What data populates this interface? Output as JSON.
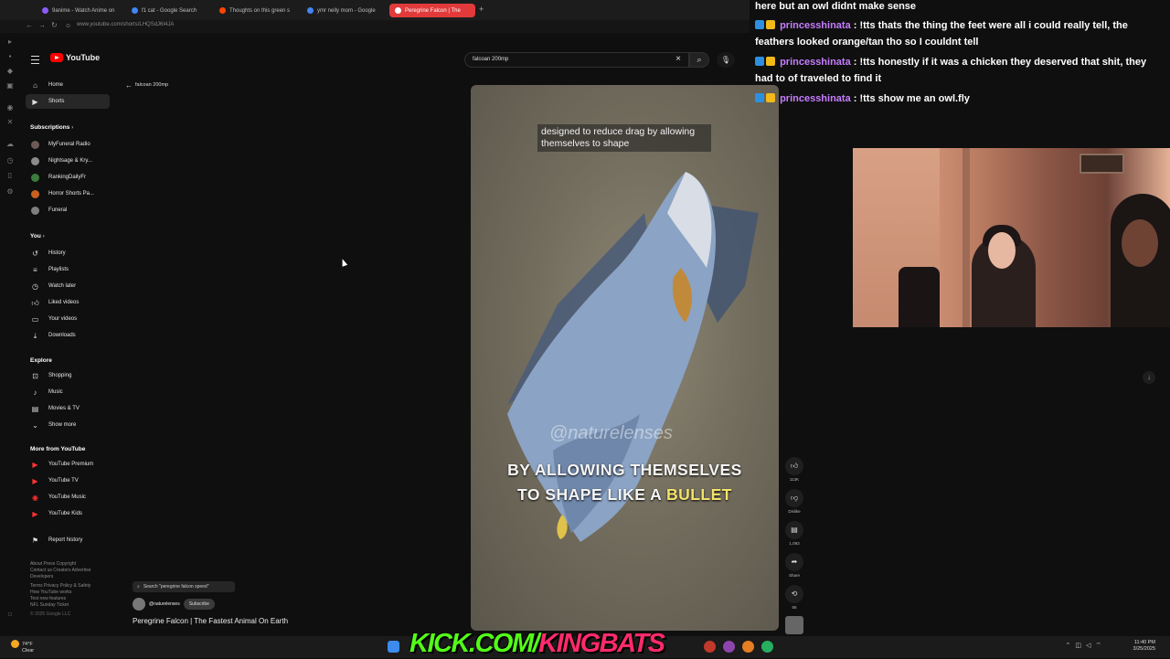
{
  "browser": {
    "tabs": [
      {
        "label": "9anime - Watch Anime on",
        "color": "#8a5cf6"
      },
      {
        "label": "f1 cat - Google Search",
        "color": "#4285f4"
      },
      {
        "label": "Thoughts on this green s",
        "color": "#ff4500"
      },
      {
        "label": "ymr nelly mom - Google",
        "color": "#4285f4"
      },
      {
        "label": "Peregrine Falcon | The",
        "color": "#ff0000"
      }
    ],
    "url": "www.youtube.com/shorts/LHQSdJ6I4JA"
  },
  "youtube": {
    "brand": "YouTube",
    "search": {
      "query": "falcoan 200mp"
    },
    "back_label": "falcoan 200mp",
    "nav": [
      {
        "label": "Home",
        "icon": "home-icon"
      },
      {
        "label": "Shorts",
        "icon": "shorts-icon"
      }
    ],
    "subscriptions_title": "Subscriptions",
    "subscriptions": [
      {
        "label": "MyFuneral Radio"
      },
      {
        "label": "Nightsage & Kry..."
      },
      {
        "label": "RankingDailyFr"
      },
      {
        "label": "Horror Shorts Pa..."
      },
      {
        "label": "Funeral"
      }
    ],
    "you_title": "You",
    "you": [
      {
        "label": "History"
      },
      {
        "label": "Playlists"
      },
      {
        "label": "Watch later"
      },
      {
        "label": "Liked videos"
      },
      {
        "label": "Your videos"
      },
      {
        "label": "Downloads"
      }
    ],
    "explore_title": "Explore",
    "explore": [
      {
        "label": "Shopping"
      },
      {
        "label": "Music"
      },
      {
        "label": "Movies & TV"
      },
      {
        "label": "Show more"
      }
    ],
    "more_title": "More from YouTube",
    "more": [
      {
        "label": "YouTube Premium"
      },
      {
        "label": "YouTube TV"
      },
      {
        "label": "YouTube Music"
      },
      {
        "label": "YouTube Kids"
      }
    ],
    "report": "Report history",
    "footer": {
      "line1": "About  Press  Copyright",
      "line2": "Contact us  Creators  Advertise",
      "line3": "Developers",
      "line4": "Terms  Privacy  Policy & Safety",
      "line5": "How YouTube works",
      "line6": "Test new features",
      "line7": "NFL Sunday Ticket",
      "copyright": "© 2025 Google LLC"
    },
    "video": {
      "subtitle": "designed to reduce drag by allowing themselves to shape",
      "watermark": "@naturelenses",
      "caption_line1": "BY ALLOWING THEMSELVES",
      "caption_line2_a": "TO SHAPE LIKE A ",
      "caption_line2_b": "BULLET"
    },
    "actions": {
      "likes": "113K",
      "dislike": "Dislike",
      "comments": "1,093",
      "share": "Share",
      "remix": "56"
    },
    "search_suggestion": "Search \"peregrine falcon speed\"",
    "channel": "@naturelenses",
    "subscribe": "Subscribe",
    "title": "Peregrine Falcon | The Fastest Animal On Earth"
  },
  "chat": [
    {
      "user": "",
      "text": "here but an owl didnt make sense"
    },
    {
      "user": "princesshinata",
      "text": ": !tts thats the thing the feet were all i could really tell, the feathers looked orange/tan tho so I couldnt tell"
    },
    {
      "user": "princesshinata",
      "text": ": !tts honestly if it was a chicken they deserved that shit, they had to of traveled to find it"
    },
    {
      "user": "princesshinata",
      "text": ": !tts show me an owl.fly"
    }
  ],
  "overlay": {
    "kick_prefix": "KICK.COM/",
    "kick_name": "KINGBATS"
  },
  "taskbar": {
    "temp": "74°F",
    "weather": "Clear",
    "time": "11:40 PM",
    "date": "3/25/2025"
  }
}
